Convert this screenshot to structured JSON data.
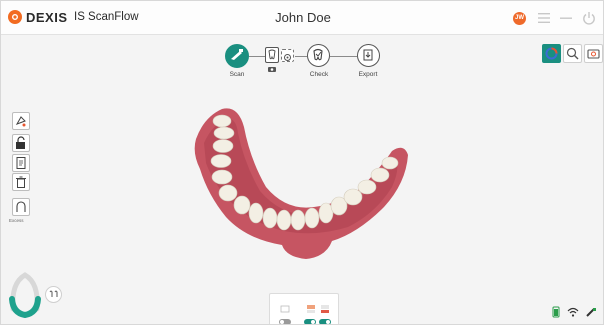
{
  "app": {
    "brand": "DEXIS",
    "product": "IS ScanFlow",
    "patient_name": "John Doe",
    "user_initials": "JW",
    "accent_color": "#1a8f80",
    "brand_color": "#f26b21"
  },
  "titlebar_icons": [
    "menu-icon",
    "minimize-icon",
    "power-icon"
  ],
  "workflow": {
    "steps": [
      {
        "label": "Scan",
        "active": true,
        "icon": "scanner-icon"
      },
      {
        "label": "",
        "active": false,
        "icon": "tooth-scan-icon"
      },
      {
        "label": "",
        "active": false,
        "icon": "settings-icon"
      },
      {
        "label": "Check",
        "active": false,
        "icon": "check-tooth-icon"
      },
      {
        "label": "Export",
        "active": false,
        "icon": "export-icon"
      }
    ]
  },
  "view_toggles": [
    "color-view-icon",
    "zoom-icon",
    "snapshot-icon"
  ],
  "left_tools": [
    "selection-tool-icon",
    "lock-icon",
    "notes-icon",
    "trash-icon",
    "trim-icon"
  ],
  "left_tool_caption": "Excess",
  "bottom_panel": {
    "labels": [
      "",
      ""
    ],
    "toggles": [
      "off",
      "on",
      "on"
    ]
  },
  "status_icons": [
    "battery-icon",
    "wifi-icon",
    "scanner-status-icon"
  ]
}
